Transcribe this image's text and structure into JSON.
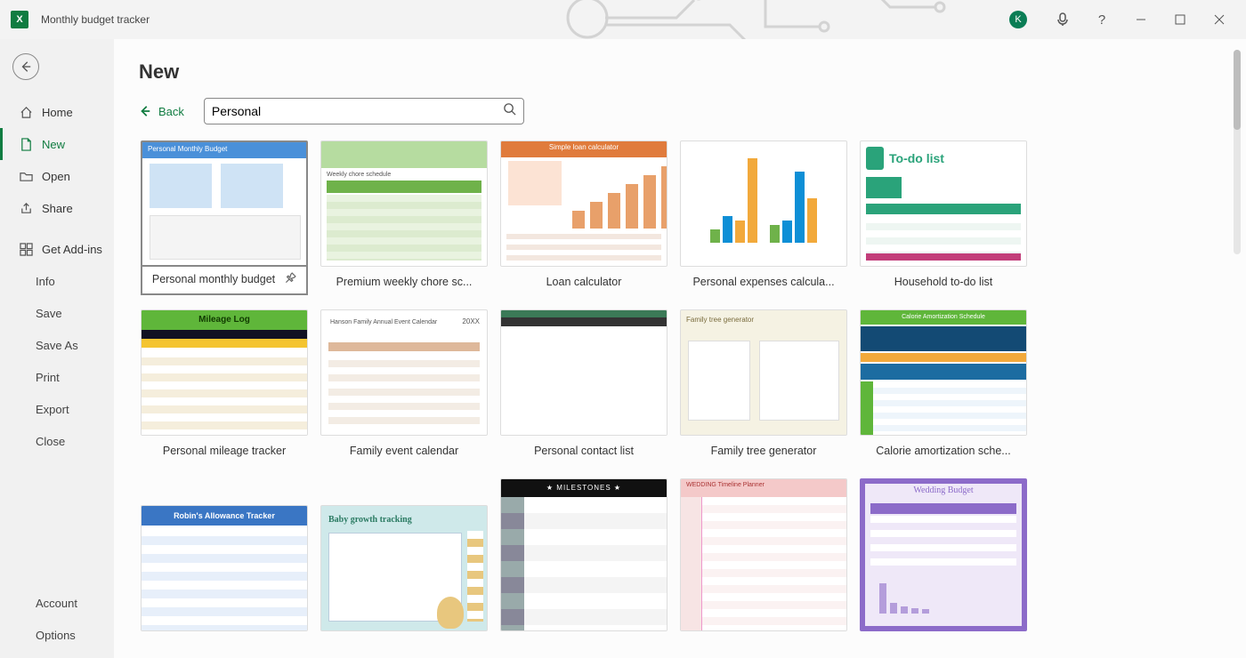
{
  "window": {
    "title": "Monthly budget tracker",
    "avatar_initial": "K"
  },
  "sidebar": {
    "items": [
      {
        "label": "Home"
      },
      {
        "label": "New"
      },
      {
        "label": "Open"
      },
      {
        "label": "Share"
      },
      {
        "label": "Get Add-ins"
      }
    ],
    "sub_items": [
      {
        "label": "Info"
      },
      {
        "label": "Save"
      },
      {
        "label": "Save As"
      },
      {
        "label": "Print"
      },
      {
        "label": "Export"
      },
      {
        "label": "Close"
      }
    ],
    "bottom": [
      {
        "label": "Account"
      },
      {
        "label": "Options"
      }
    ]
  },
  "page": {
    "title": "New",
    "back_label": "Back",
    "search_value": "Personal"
  },
  "templates": [
    {
      "label": "Personal monthly budget",
      "selected": true,
      "pinnable": true
    },
    {
      "label": "Premium weekly chore sc..."
    },
    {
      "label": "Loan calculator"
    },
    {
      "label": "Personal expenses calcula..."
    },
    {
      "label": "Household to-do list"
    },
    {
      "label": "Personal mileage tracker"
    },
    {
      "label": "Family event calendar"
    },
    {
      "label": "Personal contact list"
    },
    {
      "label": "Family tree generator"
    },
    {
      "label": "Calorie amortization sche..."
    },
    {
      "label": ""
    },
    {
      "label": ""
    },
    {
      "label": ""
    },
    {
      "label": ""
    },
    {
      "label": ""
    }
  ],
  "thumb_titles": {
    "t0": "Personal Monthly Budget",
    "t1": "Weekly chore schedule",
    "t2": "Simple loan calculator",
    "t4": "To-do list",
    "t5": "Mileage Log",
    "t8": "Family tree generator",
    "t9": "Calorie Amortization Schedule",
    "t10": "Robin's Allowance Tracker",
    "t11": "Baby growth tracking",
    "t12": "MILESTONES",
    "t13": "WEDDING Timeline Planner",
    "t14": "Wedding Budget"
  }
}
